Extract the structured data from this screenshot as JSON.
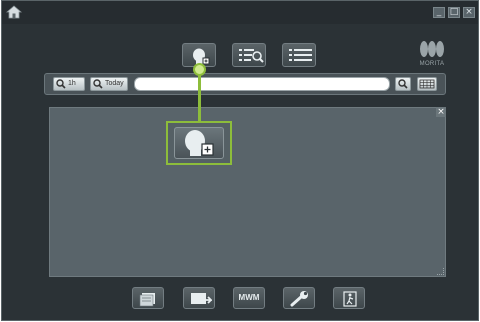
{
  "window": {
    "controls": {
      "minimize": "_",
      "maximize": "□",
      "close": "×"
    }
  },
  "toolbar": {
    "buttons": [
      {
        "icon": "patient-head-icon"
      },
      {
        "icon": "list-search-icon"
      },
      {
        "icon": "list-view-icon"
      }
    ]
  },
  "brand": {
    "logo_text": "MORITA"
  },
  "search": {
    "btn_1h": "1h",
    "btn_today": "Today",
    "query_value": ""
  },
  "panel": {
    "close_label": "×"
  },
  "bottom_toolbar": {
    "buttons": [
      {
        "icon": "image-stack-icon"
      },
      {
        "icon": "image-export-icon"
      },
      {
        "label": "MWM"
      },
      {
        "icon": "wrench-icon"
      },
      {
        "icon": "exit-door-icon"
      }
    ]
  },
  "colors": {
    "window_bg": "#2b3236",
    "panel_bg": "#59646a",
    "highlight": "#8dbd3b"
  }
}
